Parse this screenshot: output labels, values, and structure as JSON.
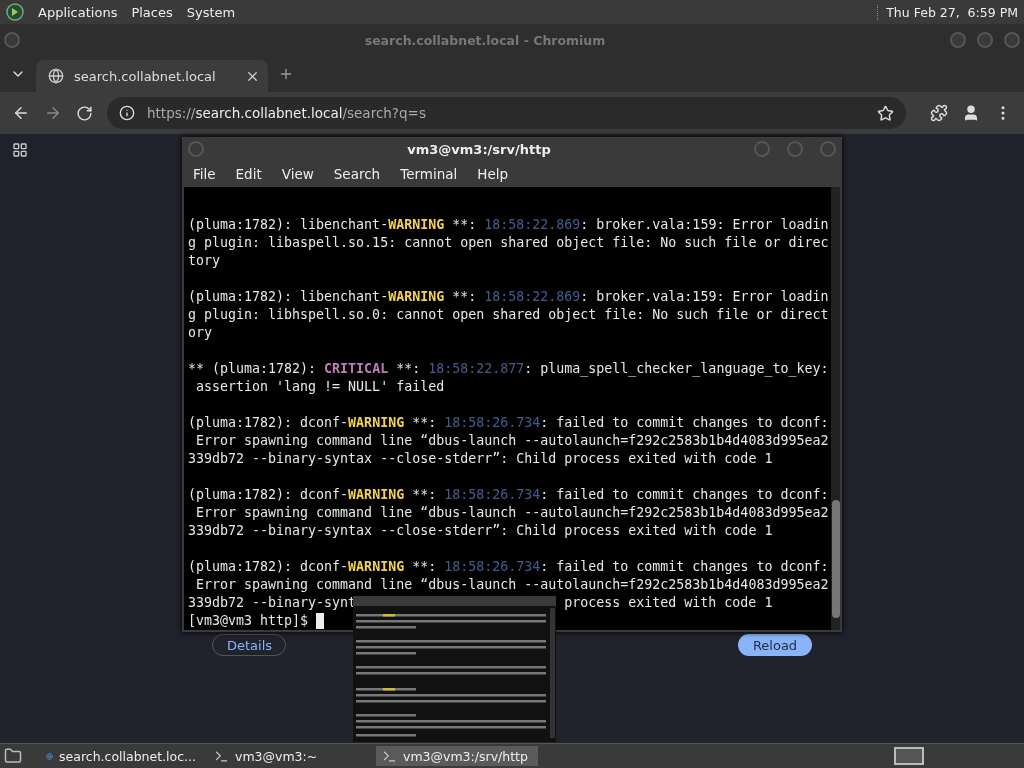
{
  "top_panel": {
    "menus": [
      "Applications",
      "Places",
      "System"
    ],
    "clock": "Thu Feb 27,  6:59 PM"
  },
  "browser": {
    "title": "search.collabnet.local - Chromium",
    "tabs": [
      {
        "label": "search.collabnet.local",
        "selected": true
      }
    ],
    "address": {
      "scheme": "https://",
      "host": "search.collabnet.local",
      "path": "/search?q=s"
    },
    "page": {
      "buttons": [
        {
          "label": "Details",
          "kind": "outline"
        },
        {
          "label": "Reload",
          "kind": "primary"
        }
      ]
    }
  },
  "terminal": {
    "title": "vm3@vm3:/srv/http",
    "menus": [
      "File",
      "Edit",
      "View",
      "Search",
      "Terminal",
      "Help"
    ],
    "entries": [
      {
        "lines": [
          {
            "obscured": false,
            "segments": [
              {
                "text": "(pluma:1782): libenchant-",
                "kind": "plain"
              },
              {
                "text": "WARNING",
                "kind": "warning"
              },
              {
                "text": " **: ",
                "kind": "plain"
              },
              {
                "text": "18:58:22.869",
                "kind": "time"
              },
              {
                "text": ": broker.vala:159: Error loadin",
                "kind": "plain"
              }
            ]
          },
          {
            "obscured": false,
            "segments": [
              {
                "text": "g plugin: libaspell.so.15: cannot open shared object file: No such file or direc",
                "kind": "plain"
              }
            ]
          },
          {
            "obscured": false,
            "segments": [
              {
                "text": "tory",
                "kind": "plain"
              }
            ]
          }
        ]
      },
      {
        "lines": [
          {
            "obscured": false,
            "segments": [
              {
                "text": "(pluma:1782): libenchant-",
                "kind": "plain"
              },
              {
                "text": "WARNING",
                "kind": "warning"
              },
              {
                "text": " **: ",
                "kind": "plain"
              },
              {
                "text": "18:58:22.869",
                "kind": "time"
              },
              {
                "text": ": broker.vala:159: Error loadin",
                "kind": "plain"
              }
            ]
          },
          {
            "obscured": false,
            "segments": [
              {
                "text": "g plugin: libhspell.so.0: cannot open shared object file: No such file or direct",
                "kind": "plain"
              }
            ]
          },
          {
            "obscured": false,
            "segments": [
              {
                "text": "ory",
                "kind": "plain"
              }
            ]
          }
        ]
      },
      {
        "lines": [
          {
            "obscured": false,
            "segments": [
              {
                "text": "** (pluma:1782): ",
                "kind": "plain"
              },
              {
                "text": "CRITICAL",
                "kind": "critical"
              },
              {
                "text": " **: ",
                "kind": "plain"
              },
              {
                "text": "18:58:22.877",
                "kind": "time"
              },
              {
                "text": ": pluma_spell_checker_language_to_key:",
                "kind": "plain"
              }
            ]
          },
          {
            "obscured": false,
            "segments": [
              {
                "text": " assertion 'lang != NULL' failed",
                "kind": "plain"
              }
            ]
          }
        ]
      },
      {
        "lines": [
          {
            "obscured": false,
            "segments": [
              {
                "text": "(pluma:1782): dconf-",
                "kind": "plain"
              },
              {
                "text": "WARNING",
                "kind": "warning"
              },
              {
                "text": " **: ",
                "kind": "plain"
              },
              {
                "text": "18:58:26.734",
                "kind": "time"
              },
              {
                "text": ": failed to commit changes to dconf:",
                "kind": "plain"
              }
            ]
          },
          {
            "obscured": false,
            "segments": [
              {
                "text": " Error spawning command line “dbus-launch --autolaunch=f292c2583b1b4d4083d995ea2",
                "kind": "plain"
              }
            ]
          },
          {
            "obscured": false,
            "segments": [
              {
                "text": "339db72 --binary-syntax --close-stderr”: Child process exited with code 1",
                "kind": "plain"
              }
            ]
          }
        ]
      },
      {
        "lines": [
          {
            "obscured": false,
            "segments": [
              {
                "text": "(pluma:1782): dconf-",
                "kind": "plain"
              },
              {
                "text": "WARNING",
                "kind": "warning"
              },
              {
                "text": " **: ",
                "kind": "plain"
              },
              {
                "text": "18:58:26.734",
                "kind": "time"
              },
              {
                "text": ": failed to commit changes to dconf:",
                "kind": "plain"
              }
            ]
          },
          {
            "obscured": false,
            "segments": [
              {
                "text": " Error spawning command line “dbus-launch --autolaunch=f292c2583b1b4d4083d995ea2",
                "kind": "plain"
              }
            ]
          },
          {
            "obscured": false,
            "segments": [
              {
                "text": "339db72 --binary-syntax --close-stderr”: Child process exited with code 1",
                "kind": "plain"
              }
            ]
          }
        ]
      },
      {
        "lines": [
          {
            "obscured": false,
            "segments": [
              {
                "text": "(pluma:1782): dconf-",
                "kind": "plain"
              },
              {
                "text": "WARNING",
                "kind": "warning"
              },
              {
                "text": " **: ",
                "kind": "plain"
              },
              {
                "text": "18:58:26.734",
                "kind": "time"
              },
              {
                "text": ": failed to commit changes to dconf:",
                "kind": "plain"
              }
            ]
          },
          {
            "obscured": false,
            "segments": [
              {
                "text": " Error spawning command line “dbus-launch --autolaunch=f292c2583b1b4d4083d995ea2",
                "kind": "plain"
              }
            ]
          },
          {
            "obscured": true,
            "segments": [
              {
                "text": "339db72 --binary-synt",
                "kind": "plain"
              },
              {
                "text": "process exited with code 1",
                "kind": "plain"
              }
            ]
          }
        ]
      }
    ],
    "prompt": "[vm3@vm3 http]$"
  },
  "taskbar": {
    "items": [
      {
        "label": "search.collabnet.loc...",
        "kind": "browser",
        "selected": false
      },
      {
        "label": "vm3@vm3:~",
        "kind": "terminal",
        "selected": false
      },
      {
        "label": "vm3@vm3:/srv/http",
        "kind": "terminal",
        "selected": true
      }
    ]
  }
}
